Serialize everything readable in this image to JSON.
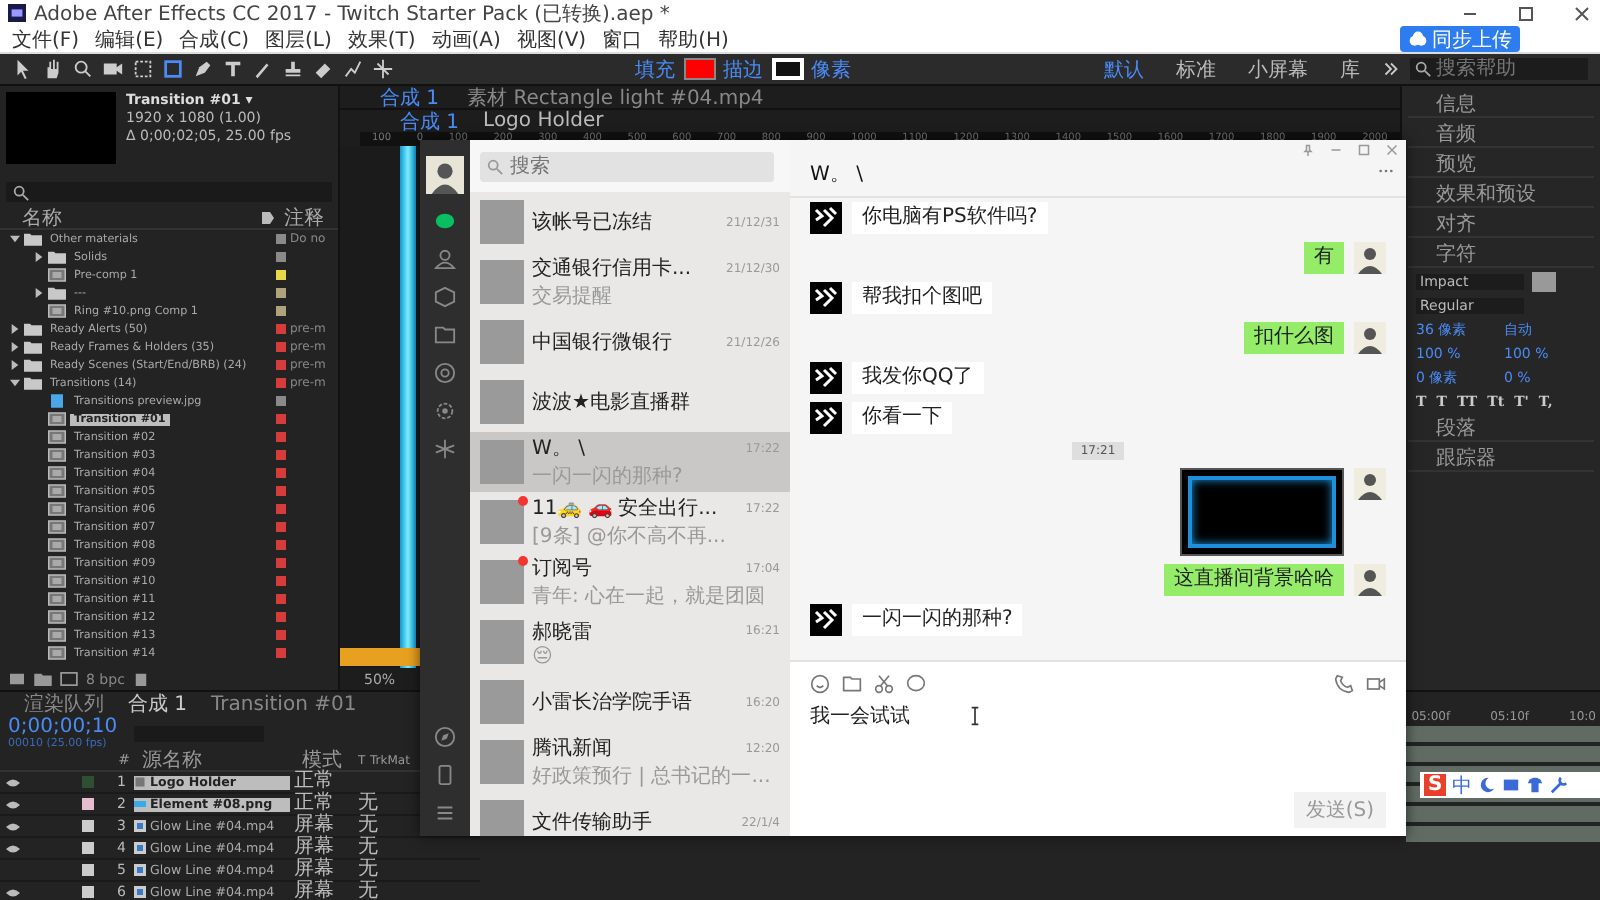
{
  "window": {
    "title": "Adobe After Effects CC 2017 - Twitch Starter Pack (已转换).aep *"
  },
  "menu": [
    "文件(F)",
    "编辑(E)",
    "合成(C)",
    "图层(L)",
    "效果(T)",
    "动画(A)",
    "视图(V)",
    "窗口",
    "帮助(H)"
  ],
  "toolbar": {
    "fill": {
      "label": "填充",
      "color": "#ff0000"
    },
    "stroke": {
      "label": "描边",
      "color": "#ffffff"
    },
    "stroke_unit": "像素",
    "workspaces": [
      {
        "label": "默认",
        "selected": true
      },
      {
        "label": "标准",
        "selected": false
      },
      {
        "label": "小屏幕",
        "selected": false
      },
      {
        "label": "库",
        "selected": false
      }
    ],
    "help_search": {
      "placeholder": "搜索帮助"
    }
  },
  "upload_badge": "同步上传",
  "project": {
    "title": "Transition #01 ▾",
    "dims": "1920 x 1080 (1.00)",
    "duration": "Δ 0;00;02;05, 25.00 fps",
    "columns": [
      "名称",
      "注释"
    ],
    "bpc": "8 bpc",
    "items": [
      {
        "name": "Other materials",
        "kind": "folder",
        "color": "#8a8a8a",
        "comment": "Do no",
        "expanded": true,
        "selected": false,
        "children": [
          {
            "name": "Solids",
            "kind": "folder",
            "color": "#8a8a8a",
            "expanded": false,
            "selected": false
          },
          {
            "name": "Pre-comp 1",
            "kind": "comp",
            "color": "#e8d84a",
            "selected": false
          },
          {
            "name": "---",
            "kind": "folder",
            "color": "#b0a27a",
            "expanded": false,
            "selected": false
          },
          {
            "name": "Ring #10.png Comp 1",
            "kind": "comp",
            "color": "#b0a27a",
            "selected": false
          }
        ]
      },
      {
        "name": "Ready Alerts (50)",
        "kind": "folder",
        "color": "#d63c3c",
        "comment": "pre-m",
        "expanded": false,
        "selected": false
      },
      {
        "name": "Ready Frames & Holders (35)",
        "kind": "folder",
        "color": "#d63c3c",
        "comment": "pre-m",
        "expanded": false,
        "selected": false
      },
      {
        "name": "Ready Scenes (Start/End/BRB) (24)",
        "kind": "folder",
        "color": "#d63c3c",
        "comment": "pre-m",
        "expanded": false,
        "selected": false
      },
      {
        "name": "Transitions (14)",
        "kind": "folder",
        "color": "#d63c3c",
        "comment": "pre-m",
        "expanded": true,
        "selected": false,
        "children": [
          {
            "name": "Transitions preview.jpg",
            "kind": "image",
            "color": "#8a8a8a",
            "selected": false
          },
          {
            "name": "Transition #01",
            "kind": "comp",
            "color": "#d63c3c",
            "selected": true
          },
          {
            "name": "Transition #02",
            "kind": "comp",
            "color": "#d63c3c",
            "selected": false
          },
          {
            "name": "Transition #03",
            "kind": "comp",
            "color": "#d63c3c",
            "selected": false
          },
          {
            "name": "Transition #04",
            "kind": "comp",
            "color": "#d63c3c",
            "selected": false
          },
          {
            "name": "Transition #05",
            "kind": "comp",
            "color": "#d63c3c",
            "selected": false
          },
          {
            "name": "Transition #06",
            "kind": "comp",
            "color": "#d63c3c",
            "selected": false
          },
          {
            "name": "Transition #07",
            "kind": "comp",
            "color": "#d63c3c",
            "selected": false
          },
          {
            "name": "Transition #08",
            "kind": "comp",
            "color": "#d63c3c",
            "selected": false
          },
          {
            "name": "Transition #09",
            "kind": "comp",
            "color": "#d63c3c",
            "selected": false
          },
          {
            "name": "Transition #10",
            "kind": "comp",
            "color": "#d63c3c",
            "selected": false
          },
          {
            "name": "Transition #11",
            "kind": "comp",
            "color": "#d63c3c",
            "selected": false
          },
          {
            "name": "Transition #12",
            "kind": "comp",
            "color": "#d63c3c",
            "selected": false
          },
          {
            "name": "Transition #13",
            "kind": "comp",
            "color": "#d63c3c",
            "selected": false
          },
          {
            "name": "Transition #14",
            "kind": "comp",
            "color": "#d63c3c",
            "selected": false
          }
        ]
      }
    ]
  },
  "viewer": {
    "tabs": [
      {
        "label": "合成 1",
        "selected": true
      },
      {
        "label": "素材 Rectangle light #04.mp4",
        "selected": false
      }
    ],
    "breadcrumbs": [
      "合成 1",
      "Logo Holder"
    ],
    "ruler": [
      "100",
      "0",
      "100",
      "200",
      "300",
      "400",
      "500",
      "600",
      "700",
      "800",
      "900",
      "1000",
      "1100",
      "1200",
      "1300",
      "1400",
      "1500",
      "1600",
      "1700",
      "1800",
      "1900",
      "2000"
    ],
    "zoom": "50%"
  },
  "right_panel": {
    "sections": [
      "信息",
      "音频",
      "预览",
      "效果和预设",
      "对齐"
    ],
    "character": {
      "title": "字符",
      "font": "Impact",
      "style": "Regular",
      "size": "36 像素",
      "leading": "自动",
      "vscale": "100 %",
      "hscale": "100 %",
      "tsume": "0 %",
      "baseline": "0 像素",
      "styles": [
        "T",
        "T",
        "TT",
        "Tt",
        "T'",
        "T,"
      ]
    },
    "sections_after": [
      "段落",
      "跟踪器"
    ]
  },
  "timeline": {
    "tabs": [
      {
        "label": "渲染队列",
        "selected": false
      },
      {
        "label": "合成 1",
        "selected": true
      },
      {
        "label": "Transition #01",
        "selected": false
      }
    ],
    "timecode": "0;00;00;10",
    "frame_info": "00010 (25.00 fps)",
    "columns": [
      "#",
      "源名称",
      "模式",
      "T",
      "TrkMat"
    ],
    "ruler": [
      "05:00f",
      "05:10f",
      "10:0"
    ],
    "layers": [
      {
        "num": "1",
        "name": "Logo Holder",
        "kind": "comp",
        "mode": "正常",
        "visible": true,
        "selected": true,
        "color": "#2f4f32"
      },
      {
        "num": "2",
        "name": "Element #08.png",
        "kind": "image",
        "mode": "正常",
        "trkmat": "无",
        "visible": true,
        "selected": true,
        "color": "#e6bcd0"
      },
      {
        "num": "3",
        "name": "Glow Line #04.mp4",
        "kind": "video",
        "mode": "屏幕",
        "trkmat": "无",
        "visible": true,
        "selected": false,
        "color": "#cccccc"
      },
      {
        "num": "4",
        "name": "Glow Line #04.mp4",
        "kind": "video",
        "mode": "屏幕",
        "trkmat": "无",
        "visible": true,
        "selected": false,
        "color": "#cccccc"
      },
      {
        "num": "5",
        "name": "Glow Line #04.mp4",
        "kind": "video",
        "mode": "屏幕",
        "trkmat": "无",
        "visible": false,
        "selected": false,
        "color": "#cccccc"
      },
      {
        "num": "6",
        "name": "Glow Line #04.mp4",
        "kind": "video",
        "mode": "屏幕",
        "trkmat": "无",
        "visible": true,
        "selected": false,
        "color": "#cccccc"
      }
    ]
  },
  "ime": {
    "logo": "S",
    "mode": "中"
  },
  "wechat": {
    "search": {
      "placeholder": "搜索"
    },
    "chats": [
      {
        "name": "该帐号已冻结",
        "time": "21/12/31",
        "unread": false,
        "selected": false
      },
      {
        "name": "交通银行信用卡...",
        "time": "21/12/30",
        "preview": "交易提醒",
        "unread": false,
        "selected": false
      },
      {
        "name": "中国银行微银行",
        "time": "21/12/26",
        "unread": false,
        "selected": false
      },
      {
        "name": "波波★电影直播群",
        "unread": false,
        "selected": false
      },
      {
        "name": "W。 \\",
        "time": "17:22",
        "preview": "一闪一闪的那种?",
        "unread": false,
        "selected": true
      },
      {
        "name": "11🚕 🚗 安全出行...",
        "time": "17:22",
        "preview": "[9条] @你不高不再...",
        "unread": true,
        "selected": false
      },
      {
        "name": "订阅号",
        "time": "17:04",
        "preview": "青年: 心在一起，就是团圆",
        "unread": true,
        "selected": false
      },
      {
        "name": "郝晓雷",
        "time": "16:21",
        "preview": "😔",
        "unread": false,
        "selected": false
      },
      {
        "name": "小雷长治学院手语",
        "time": "16:20",
        "unread": false,
        "selected": false
      },
      {
        "name": "腾讯新闻",
        "time": "12:20",
        "preview": "好政策预行 | 总书记的一...",
        "unread": false,
        "selected": false
      },
      {
        "name": "文件传输助手",
        "time": "22/1/4",
        "unread": false,
        "selected": false
      }
    ],
    "conversation": {
      "title": "W。 \\",
      "draft": "我一会试试",
      "send": "发送(S)",
      "messages": [
        {
          "kind": "text",
          "mine": false,
          "text": "你电脑有PS软件吗?"
        },
        {
          "kind": "text",
          "mine": true,
          "text": "有"
        },
        {
          "kind": "text",
          "mine": false,
          "text": "帮我扣个图吧"
        },
        {
          "kind": "text",
          "mine": true,
          "text": "扣什么图"
        },
        {
          "kind": "text",
          "mine": false,
          "text": "我发你QQ了"
        },
        {
          "kind": "text",
          "mine": false,
          "text": "你看一下"
        },
        {
          "kind": "time",
          "text": "17:21"
        },
        {
          "kind": "image",
          "mine": true
        },
        {
          "kind": "text",
          "mine": true,
          "text": "这直播间背景哈哈"
        },
        {
          "kind": "text",
          "mine": false,
          "text": "一闪一闪的那种?"
        }
      ]
    }
  }
}
